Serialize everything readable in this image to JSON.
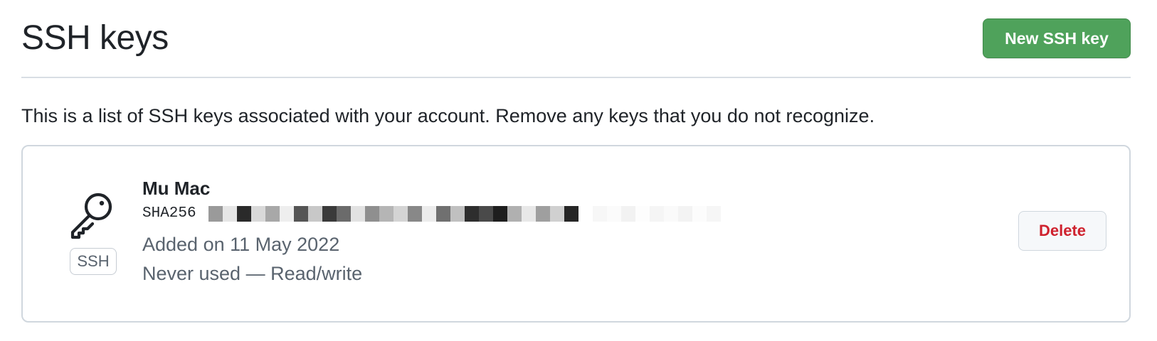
{
  "header": {
    "title": "SSH keys",
    "new_key_label": "New SSH key"
  },
  "description": "This is a list of SSH keys associated with your account. Remove any keys that you do not recognize.",
  "ssh_keys": [
    {
      "type_label": "SSH",
      "icon": "key-icon",
      "title": "Mu Mac",
      "fingerprint_visible": "SHA256",
      "fingerprint_redacted": true,
      "added": "Added on 11 May 2022",
      "usage": "Never used — Read/write",
      "delete_label": "Delete"
    }
  ],
  "colors": {
    "primary_button": "#4fa25b",
    "danger_text": "#cf222e",
    "muted_text": "#59636e",
    "border": "#d0d7de"
  }
}
